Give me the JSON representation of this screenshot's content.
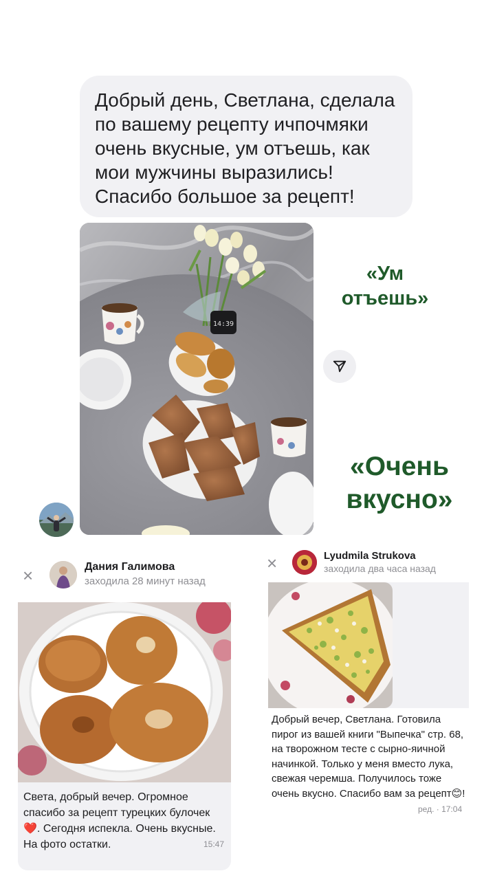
{
  "top_message": {
    "text": "Добрый день, Светлана, сделала\nпо вашему рецепту ичпочмяки\nочень вкусные, ум отъешь, как\nмои мужчины выразились!\nСпасибо большое за рецепт!"
  },
  "main_photo": {
    "clock_text": "14:39"
  },
  "quotes": {
    "first": "«Ум отъешь»",
    "second": "«Очень вкусно»"
  },
  "review_left": {
    "close_symbol": "×",
    "author_name": "Дания Галимова",
    "status": "заходила 28 минут назад",
    "message": "Света, добрый вечер. Огромное спасибо за рецепт турецких булочек ❤️. Сегодня испекла. Очень вкусные.  На фото остатки.",
    "time": "15:47"
  },
  "review_right": {
    "close_symbol": "×",
    "author_name": "Lyudmila Strukova",
    "status": "заходила два часа назад",
    "message": "Добрый вечер, Светлана. Готовила пирог из вашей книги \"Выпечка\" стр. 68, на творожном тесте с сырно-яичной начинкой. Только у меня вместо лука, свежая черемша. Получилось тоже очень вкусно. Спасибо вам за рецепт😊!",
    "time": "ред. · 17:04"
  },
  "icons": {
    "share": "share-arrow-icon",
    "close": "close-icon"
  },
  "colors": {
    "quote_green": "#1f5a2a",
    "bubble_gray": "#f1f1f4",
    "meta_gray": "#8e8e93"
  }
}
